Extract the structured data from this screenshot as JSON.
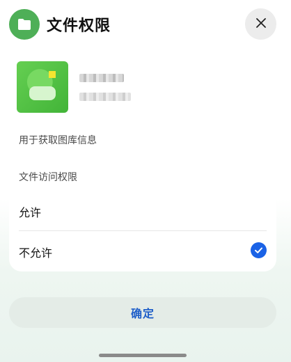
{
  "header": {
    "title": "文件权限",
    "app_icon": "folder-icon",
    "close_icon": "close-icon"
  },
  "app_info": {
    "usage_text": "用于获取图库信息"
  },
  "permission": {
    "section_label": "文件访问权限",
    "options": [
      {
        "label": "允许",
        "selected": false
      },
      {
        "label": "不允许",
        "selected": true
      }
    ],
    "selected_icon": "checkmark-circle-icon"
  },
  "footer": {
    "confirm_label": "确定"
  },
  "colors": {
    "brand_green": "#4eaf57",
    "accent_blue": "#1a62e6",
    "confirm_bg": "#e4ece7"
  }
}
